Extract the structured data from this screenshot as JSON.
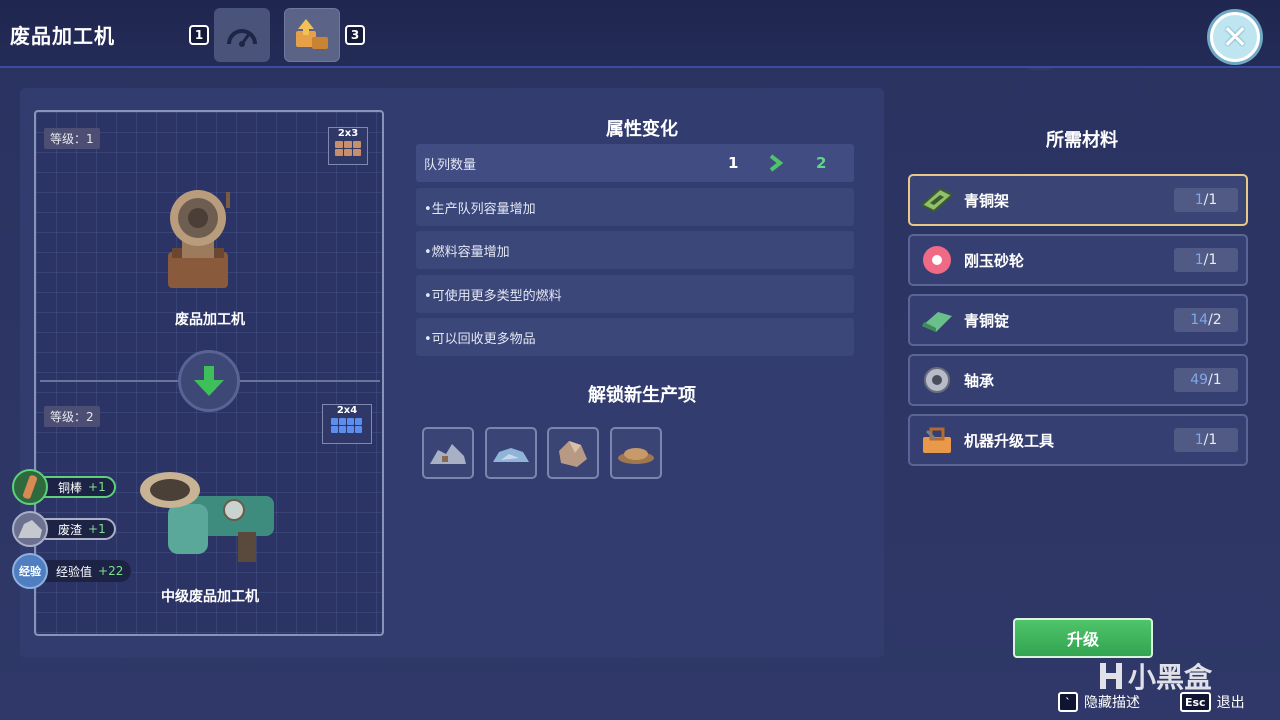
{
  "header": {
    "title": "废品加工机",
    "tab_key_left": "1",
    "tab_key_right": "3"
  },
  "machine_panel": {
    "current": {
      "level_label": "等级：1",
      "size": "2x3",
      "name": "废品加工机"
    },
    "next": {
      "level_label": "等级：2",
      "size": "2x4",
      "name": "中级废品加工机"
    },
    "rewards": [
      {
        "name": "铜棒",
        "amount": "+1",
        "icon": "copper-rod-icon"
      },
      {
        "name": "废渣",
        "amount": "+1",
        "icon": "slag-icon"
      },
      {
        "name": "经验值",
        "amount": "+22",
        "icon": "experience-icon",
        "icon_text": "经验"
      }
    ]
  },
  "attributes": {
    "title": "属性变化",
    "queue": {
      "label": "队列数量",
      "from": "1",
      "to": "2"
    },
    "items": [
      "•生产队列容量增加",
      "•燃料容量增加",
      "•可使用更多类型的燃料",
      "•可以回收更多物品"
    ]
  },
  "unlock": {
    "title": "解锁新生产项",
    "slots": [
      "scrap-pile-1-icon",
      "scrap-pile-2-icon",
      "rock-chunk-icon",
      "dust-pile-icon"
    ]
  },
  "materials": {
    "title": "所需材料",
    "items": [
      {
        "name": "青铜架",
        "have": "1",
        "need": "/1",
        "icon": "bronze-frame-icon"
      },
      {
        "name": "刚玉砂轮",
        "have": "1",
        "need": "/1",
        "icon": "grinding-wheel-icon"
      },
      {
        "name": "青铜锭",
        "have": "14",
        "need": "/2",
        "icon": "bronze-ingot-icon"
      },
      {
        "name": "轴承",
        "have": "49",
        "need": "/1",
        "icon": "bearing-icon"
      },
      {
        "name": "机器升级工具",
        "have": "1",
        "need": "/1",
        "icon": "toolbox-icon"
      }
    ]
  },
  "actions": {
    "upgrade_label": "升级",
    "hide_desc_key": "`",
    "hide_desc_label": "隐藏描述",
    "exit_key": "Esc",
    "exit_label": "退出"
  },
  "watermark": "小黑盒",
  "colors": {
    "accent_green": "#4fc46a",
    "selected_border": "#e6c889",
    "have_count": "#7fa8e8"
  }
}
